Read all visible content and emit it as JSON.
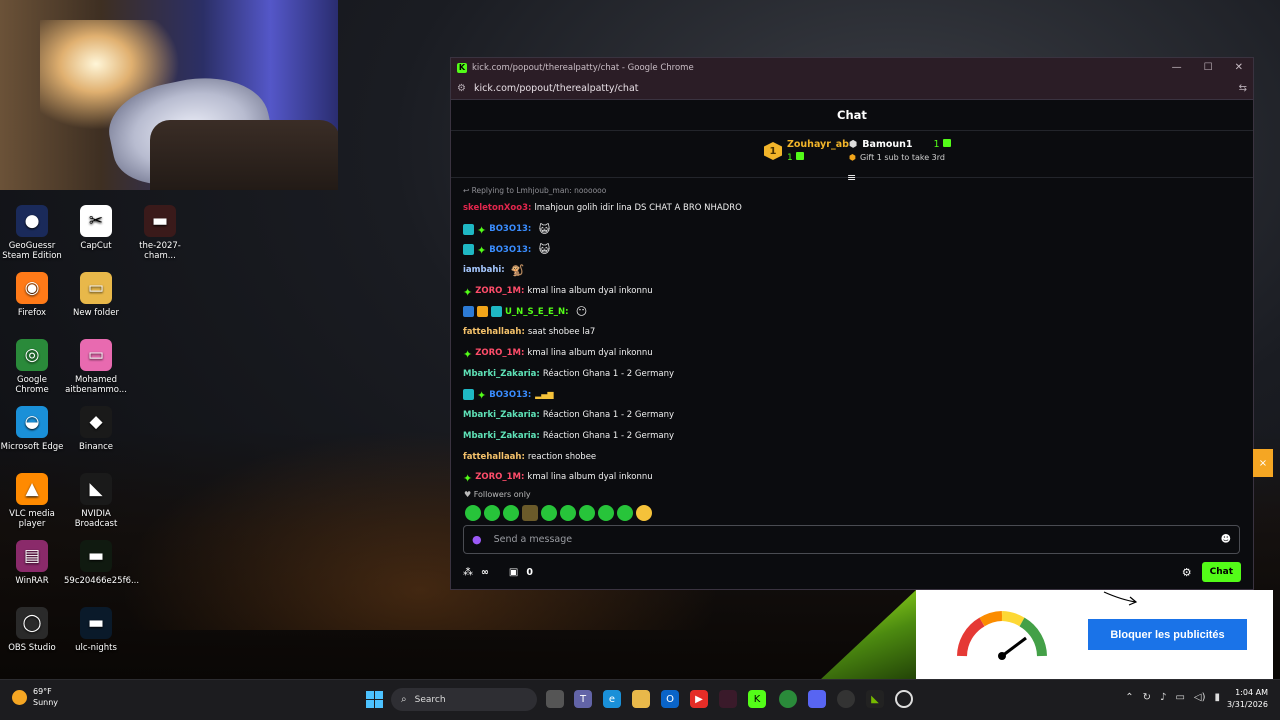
{
  "desktop_icons": [
    {
      "label": "GeoGuessr Steam Edition",
      "glyph": "●",
      "color": "#1a2a5a"
    },
    {
      "label": "CapCut",
      "glyph": "✂",
      "color": "#ffffff"
    },
    {
      "label": "the-2027-cham...",
      "glyph": "▬",
      "color": "#3a1a1a"
    },
    {
      "label": "Firefox",
      "glyph": "◉",
      "color": "#ff7a18"
    },
    {
      "label": "New folder",
      "glyph": "▭",
      "color": "#e8b84a"
    },
    {
      "label": "Google Chrome",
      "glyph": "◎",
      "color": "#2a8a3a"
    },
    {
      "label": "Mohamed aitbenammo...",
      "glyph": "▭",
      "color": "#e86ab0"
    },
    {
      "label": "Microsoft Edge",
      "glyph": "◒",
      "color": "#1a90d8"
    },
    {
      "label": "Binance",
      "glyph": "◆",
      "color": "#1a1a1a"
    },
    {
      "label": "VLC media player",
      "glyph": "▲",
      "color": "#ff8a00"
    },
    {
      "label": "NVIDIA Broadcast",
      "glyph": "◣",
      "color": "#1a1a1a"
    },
    {
      "label": "WinRAR",
      "glyph": "▤",
      "color": "#8a2a6a"
    },
    {
      "label": "59c20466e25f6...",
      "glyph": "▬",
      "color": "#101a10"
    },
    {
      "label": "OBS Studio",
      "glyph": "◯",
      "color": "#2a2a2a"
    },
    {
      "label": "ulc-nights",
      "glyph": "▬",
      "color": "#0a1a2a"
    }
  ],
  "window": {
    "title": "kick.com/popout/therealpatty/chat - Google Chrome",
    "url": "kick.com/popout/therealpatty/chat",
    "favicon": "K"
  },
  "chat": {
    "header": "Chat",
    "leaderboard": {
      "first": {
        "rank": "1",
        "name": "Zouhayr_ab",
        "count": "1"
      },
      "second": {
        "name": "Bamoun1",
        "count": "1",
        "gift_text": "Gift 1 sub to take 3rd"
      }
    },
    "reply_text": "Replying to Lmhjoub_man: noooooo",
    "messages": [
      {
        "user": "skeletonXoo3:",
        "color": "#e2264d",
        "badges": [],
        "text": "lmahjoun golih idir lina DS CHAT A BRO NHADRO",
        "emote": ""
      },
      {
        "user": "BO3O13:",
        "color": "#3a8dff",
        "badges": [
          "grid",
          "spark"
        ],
        "text": "",
        "emote": "😺"
      },
      {
        "user": "BO3O13:",
        "color": "#3a8dff",
        "badges": [
          "grid",
          "spark"
        ],
        "text": "",
        "emote": "😺"
      },
      {
        "user": "iambahi:",
        "color": "#a6c8ff",
        "badges": [],
        "text": "",
        "emote": "🐒"
      },
      {
        "user": "ZORO_1M:",
        "color": "#ff4d6a",
        "badges": [
          "spark"
        ],
        "text": "kmal lina album dyal inkonnu",
        "emote": ""
      },
      {
        "user": "U_N_S_E_E_N:",
        "color": "#53fc18",
        "badges": [
          "arrow",
          "crown",
          "grid"
        ],
        "text": "",
        "emote": "😶"
      },
      {
        "user": "fattehallaah:",
        "color": "#f5c26b",
        "badges": [],
        "text": "saat shobee la7",
        "emote": ""
      },
      {
        "user": "ZORO_1M:",
        "color": "#ff4d6a",
        "badges": [
          "spark"
        ],
        "text": "kmal lina album dyal inkonnu",
        "emote": ""
      },
      {
        "user": "Mbarki_Zakaria:",
        "color": "#5fe3b8",
        "badges": [],
        "text": "Réaction Ghana 1 - 2 Germany",
        "emote": ""
      },
      {
        "user": "BO3O13:",
        "color": "#3a8dff",
        "badges": [
          "grid",
          "spark"
        ],
        "text": "",
        "emote": "▂▄▆"
      },
      {
        "user": "Mbarki_Zakaria:",
        "color": "#5fe3b8",
        "badges": [],
        "text": "Réaction Ghana 1 - 2 Germany",
        "emote": ""
      },
      {
        "user": "Mbarki_Zakaria:",
        "color": "#5fe3b8",
        "badges": [],
        "text": "Réaction Ghana 1 - 2 Germany",
        "emote": ""
      },
      {
        "user": "fattehallaah:",
        "color": "#f5c26b",
        "badges": [],
        "text": "reaction shobee",
        "emote": ""
      },
      {
        "user": "ZORO_1M:",
        "color": "#ff4d6a",
        "badges": [
          "spark"
        ],
        "text": "kmal lina album dyal inkonnu",
        "emote": ""
      }
    ],
    "followers_only": "Followers only",
    "input_placeholder": "Send a message",
    "footer": {
      "points": "∞",
      "count": "0",
      "send_label": "Chat"
    }
  },
  "ad": {
    "button_label": "Bloquer les publicités",
    "close": "×"
  },
  "taskbar": {
    "weather_temp": "69°F",
    "weather_desc": "Sunny",
    "search_label": "Search",
    "time": "1:04 AM",
    "date": "3/31/2026"
  },
  "colors": {
    "kick_green": "#53fc18",
    "ad_blue": "#1a73e8",
    "gold": "#f2b52a"
  }
}
